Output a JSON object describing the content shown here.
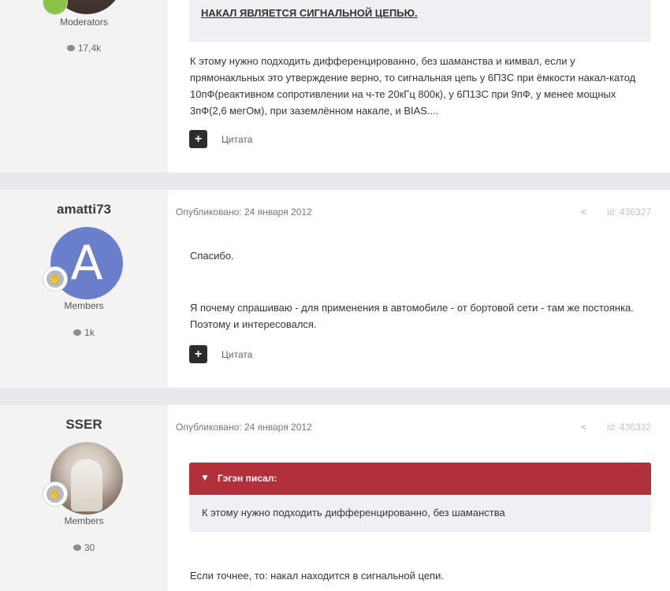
{
  "post1": {
    "group": "Moderators",
    "reactions": "17,4k",
    "quote_text": "НАКАЛ ЯВЛЯЕТСЯ СИГНАЛЬНОЙ ЦЕПЬЮ.",
    "body": "К этому нужно подходить дифференцированно, без шаманства и кимвал, если у прямонакльных это утверждение верно, то сигнальная цепь у 6П3С при ёмкости накал-катод 10пФ(реактивном сопротивлении на ч-те 20кГц 800к), у 6П13С при 9пФ, у менее мощных 3пФ(2,6 мегОм), при заземлённом накале, и BIAS....",
    "quote_button": "Цитата"
  },
  "post2": {
    "username": "amatti73",
    "avatar_letter": "A",
    "group": "Members",
    "reactions": "1k",
    "date": "Опубликовано: 24 января 2012",
    "post_id": "id: 436327",
    "line1": "Спасибо.",
    "line2": "Я почему спрашиваю - для применения в автомобиле - от бортовой сети - там же постоянка. Поэтому и интересовался.",
    "quote_button": "Цитата"
  },
  "post3": {
    "username": "SSER",
    "group": "Members",
    "reactions": "30",
    "date": "Опубликовано: 24 января 2012",
    "post_id": "id: 436332",
    "quote_author": "Гэгэн писал:",
    "quote_body": "К этому нужно подходить дифференцированно, без шаманства",
    "line1": "Если точнее, то: накал находится в сигнальной цепи."
  },
  "icons": {
    "share": "share-icon",
    "comment": "comment-bubble-icon",
    "plus": "plus-icon",
    "chevron": "chevron-down-icon"
  },
  "colors": {
    "quote_header": "#b2303b",
    "avatar_a": "#6a7fcb",
    "button_dark": "#2d2d2d"
  }
}
